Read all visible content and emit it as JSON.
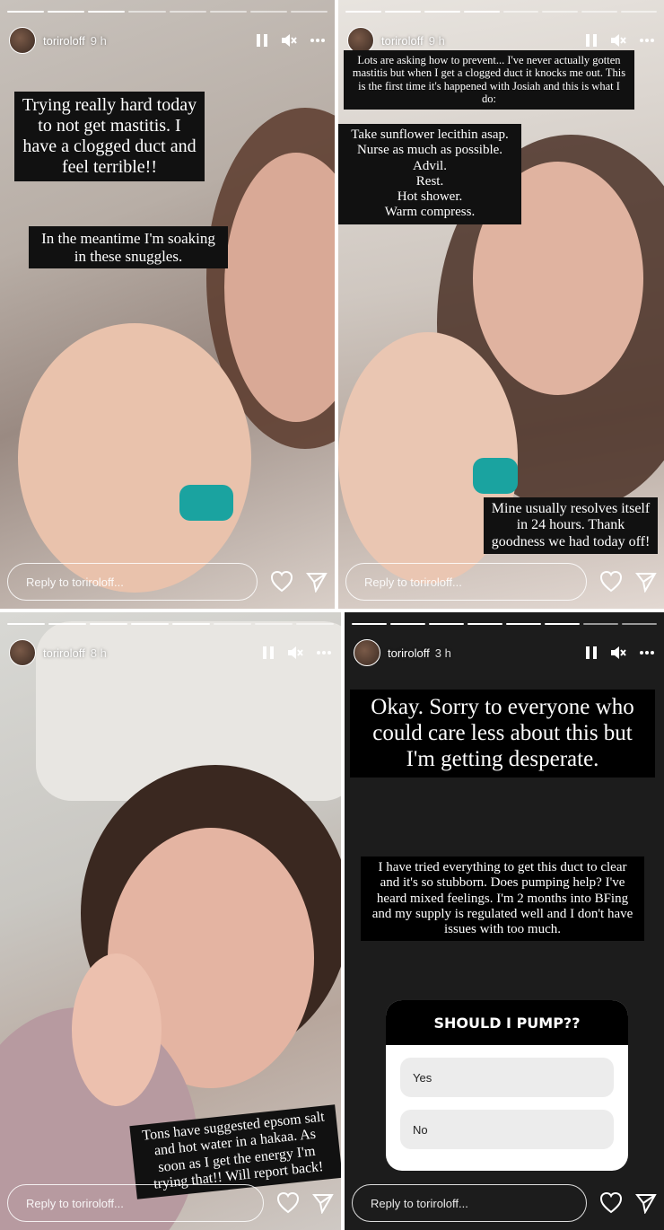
{
  "stories": [
    {
      "username": "toriroloff",
      "time": "9 h",
      "captions": [
        "Trying really hard today to not get mastitis. I have a clogged duct and feel terrible!!",
        "In the meantime I'm soaking in these snuggles."
      ],
      "reply_placeholder": "Reply to toriroloff..."
    },
    {
      "username": "toriroloff",
      "time": "9 h",
      "captions": [
        "Lots are asking how to prevent... I've never actually gotten mastitis but when I get a clogged duct it knocks me out. This is the first time it's happened with Josiah and this is what I do:",
        "Take sunflower lecithin asap.\nNurse as much as possible.\nAdvil.\nRest.\nHot shower.\nWarm compress.",
        "Mine usually resolves itself in 24 hours. Thank goodness we had today off!"
      ],
      "reply_placeholder": "Reply to toriroloff..."
    },
    {
      "username": "toriroloff",
      "time": "8 h",
      "captions": [
        "Tons have suggested epsom salt and hot water in a hakaa. As soon as I get the energy I'm trying that!! Will report back!"
      ],
      "reply_placeholder": "Reply to toriroloff..."
    },
    {
      "username": "toriroloff",
      "time": "3 h",
      "captions": [
        "Okay. Sorry to everyone who could care less about this but I'm getting desperate.",
        "I have tried everything to get this duct to clear and it's so stubborn. Does pumping help? I've heard mixed feelings. I'm 2 months into BFing and my supply is regulated well and I don't have issues with too much."
      ],
      "poll": {
        "question": "SHOULD I PUMP??",
        "options": [
          "Yes",
          "No"
        ]
      },
      "reply_placeholder": "Reply to toriroloff..."
    }
  ],
  "icons": [
    "pause-icon",
    "mute-icon",
    "more-icon",
    "heart-icon",
    "send-icon"
  ],
  "colors": {
    "caption_bg": "#111111",
    "story4_bg": "#1c1c1c"
  }
}
